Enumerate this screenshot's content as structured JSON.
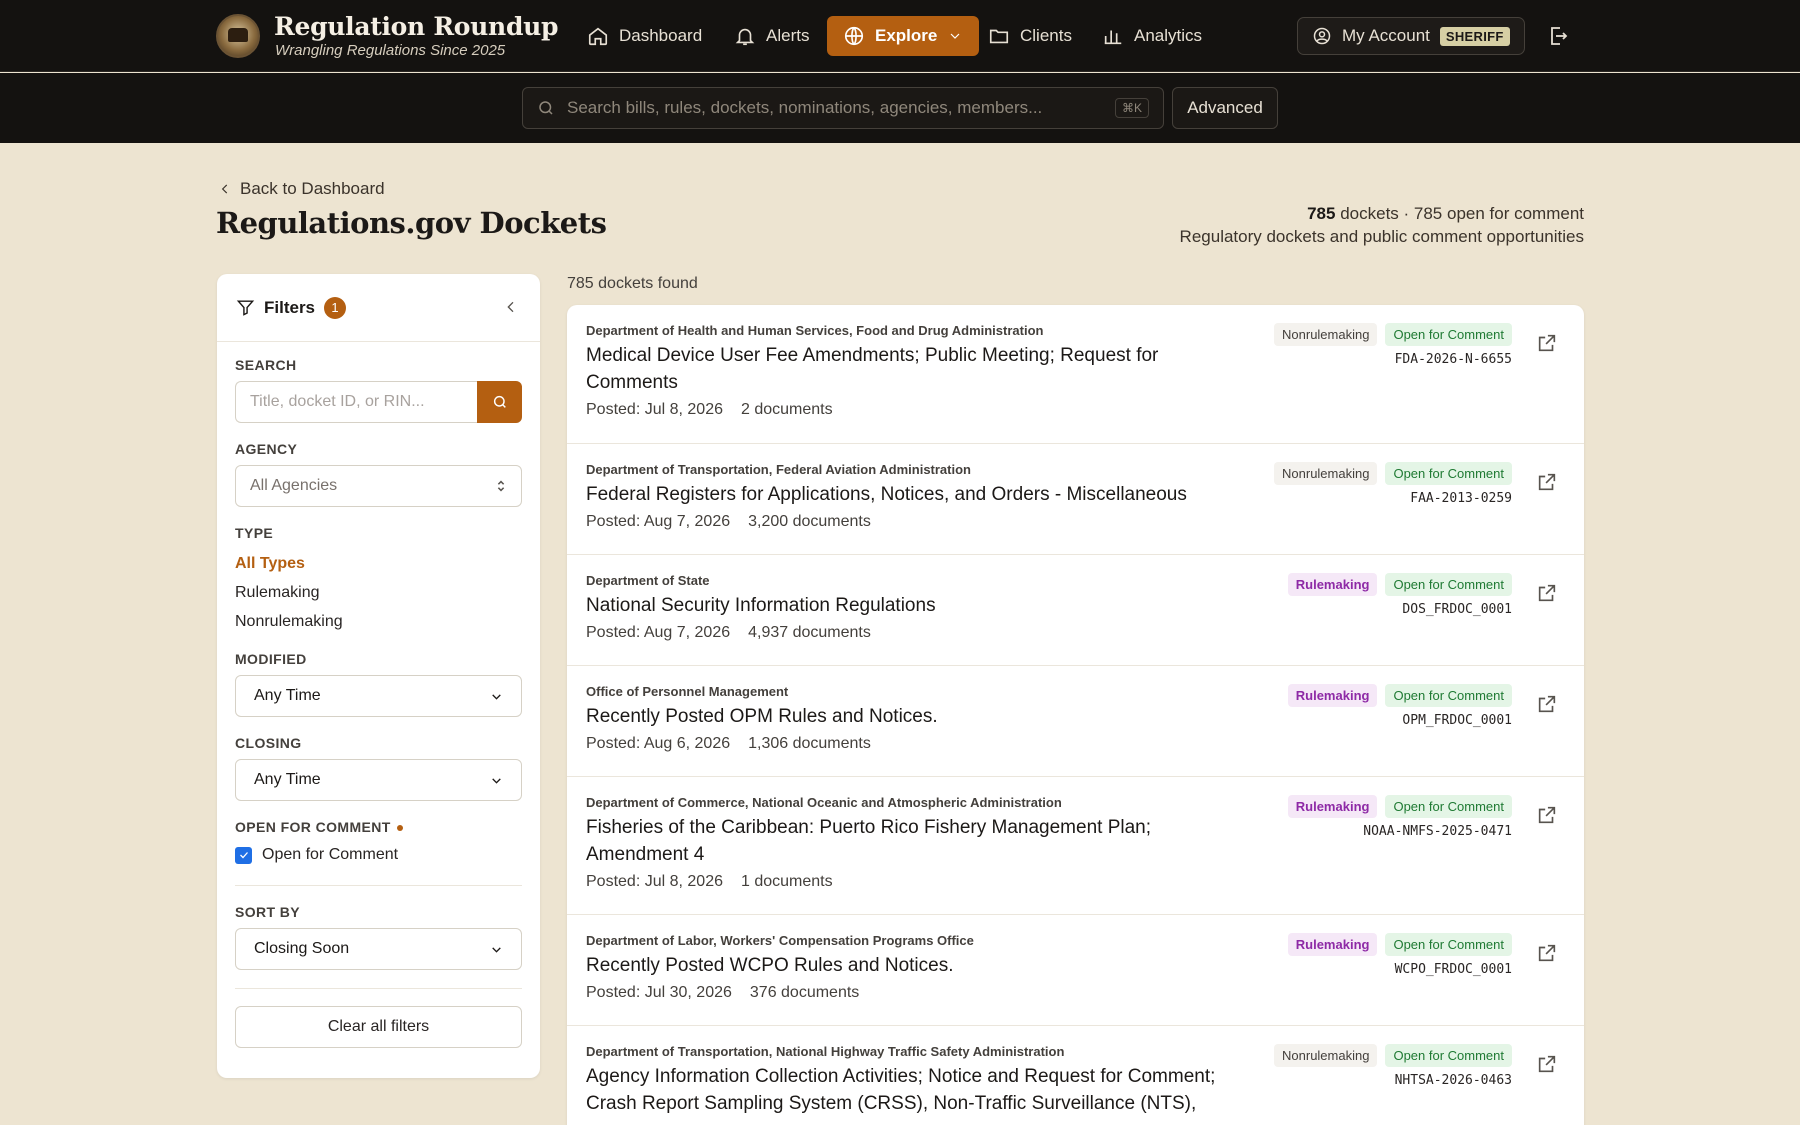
{
  "brand": {
    "title": "Regulation Roundup",
    "subtitle": "Wrangling Regulations Since 2025"
  },
  "nav": [
    {
      "label": "Dashboard",
      "icon": "home-icon"
    },
    {
      "label": "Alerts",
      "icon": "bell-icon"
    },
    {
      "label": "Explore",
      "icon": "globe-icon",
      "active": true
    },
    {
      "label": "Clients",
      "icon": "folder-icon"
    },
    {
      "label": "Analytics",
      "icon": "bar-chart-icon"
    }
  ],
  "account": {
    "label": "My Account",
    "badge": "SHERIFF"
  },
  "search": {
    "placeholder": "Search bills, rules, dockets, nominations, agencies, members...",
    "shortcut": "⌘K",
    "advanced_label": "Advanced"
  },
  "header": {
    "back_label": "Back to Dashboard",
    "title": "Regulations.gov Dockets",
    "stats_count": "785",
    "stats_rest": "dockets · 785 open for comment",
    "stats_sub": "Regulatory dockets and public comment opportunities"
  },
  "filters": {
    "title": "Filters",
    "active_count": "1",
    "search_label": "SEARCH",
    "search_placeholder": "Title, docket ID, or RIN...",
    "agency_label": "AGENCY",
    "agency_value": "All Agencies",
    "type_label": "TYPE",
    "types": [
      "All Types",
      "Rulemaking",
      "Nonrulemaking"
    ],
    "modified_label": "MODIFIED",
    "modified_value": "Any Time",
    "closing_label": "CLOSING",
    "closing_value": "Any Time",
    "open_label": "OPEN FOR COMMENT",
    "open_checkbox_label": "Open for Comment",
    "open_checked": true,
    "sort_label": "SORT BY",
    "sort_value": "Closing Soon",
    "clear_label": "Clear all filters"
  },
  "results": {
    "found_label": "785 dockets found",
    "items": [
      {
        "agency": "Department of Health and Human Services, Food and Drug Administration",
        "title": "Medical Device User Fee Amendments; Public Meeting; Request for Comments",
        "posted": "Posted: Jul 8, 2026",
        "docs": "2 documents",
        "type": "Nonrulemaking",
        "status": "Open for Comment",
        "id": "FDA-2026-N-6655"
      },
      {
        "agency": "Department of Transportation, Federal Aviation Administration",
        "title": "Federal Registers for Applications, Notices, and Orders - Miscellaneous",
        "posted": "Posted: Aug 7, 2026",
        "docs": "3,200 documents",
        "type": "Nonrulemaking",
        "status": "Open for Comment",
        "id": "FAA-2013-0259"
      },
      {
        "agency": "Department of State",
        "title": "National Security Information Regulations",
        "posted": "Posted: Aug 7, 2026",
        "docs": "4,937 documents",
        "type": "Rulemaking",
        "status": "Open for Comment",
        "id": "DOS_FRDOC_0001"
      },
      {
        "agency": "Office of Personnel Management",
        "title": "Recently Posted OPM Rules and Notices.",
        "posted": "Posted: Aug 6, 2026",
        "docs": "1,306 documents",
        "type": "Rulemaking",
        "status": "Open for Comment",
        "id": "OPM_FRDOC_0001"
      },
      {
        "agency": "Department of Commerce, National Oceanic and Atmospheric Administration",
        "title": "Fisheries of the Caribbean: Puerto Rico Fishery Management Plan; Amendment 4",
        "posted": "Posted: Jul 8, 2026",
        "docs": "1 documents",
        "type": "Rulemaking",
        "status": "Open for Comment",
        "id": "NOAA-NMFS-2025-0471"
      },
      {
        "agency": "Department of Labor, Workers' Compensation Programs Office",
        "title": "Recently Posted WCPO Rules and Notices.",
        "posted": "Posted: Jul 30, 2026",
        "docs": "376 documents",
        "type": "Rulemaking",
        "status": "Open for Comment",
        "id": "WCPO_FRDOC_0001"
      },
      {
        "agency": "Department of Transportation, National Highway Traffic Safety Administration",
        "title": "Agency Information Collection Activities; Notice and Request for Comment; Crash Report Sampling System (CRSS), Non-Traffic Surveillance (NTS),",
        "posted": "",
        "docs": "",
        "type": "Nonrulemaking",
        "status": "Open for Comment",
        "id": "NHTSA-2026-0463"
      }
    ]
  },
  "colors": {
    "accent": "#b45f11",
    "nav_bg": "#141210",
    "page_bg": "#ede4d1",
    "rulemaking": "#8e2aa6",
    "open": "#1f7a33"
  }
}
